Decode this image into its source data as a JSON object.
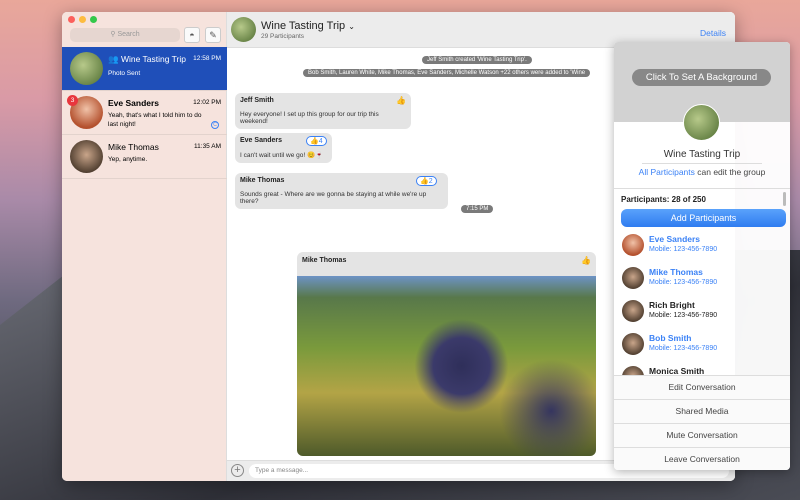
{
  "sidebar": {
    "search_placeholder": "Search",
    "conversations": [
      {
        "name": "Wine Tasting Trip",
        "time": "12:58 PM",
        "preview": "Photo Sent",
        "selected": true
      },
      {
        "name": "Eve Sanders",
        "time": "12:02 PM",
        "preview": "Yeah, that's what I told him to do last night!",
        "badge": "3"
      },
      {
        "name": "Mike Thomas",
        "time": "11:35 AM",
        "preview": "Yep, anytime."
      }
    ]
  },
  "header": {
    "title": "Wine Tasting Trip",
    "subtitle": "29 Participants",
    "details": "Details"
  },
  "chat": {
    "system": [
      "Jeff Smith created 'Wine Tasting Trip'.",
      "Bob Smith, Lauren White, Mike Thomas, Eve Sanders, Michelle Watson +22 others were added to 'Wine"
    ],
    "messages": [
      {
        "sender": "Jeff Smith",
        "text": "Hey everyone! I set up this group for our trip this weekend!"
      },
      {
        "sender": "Eve Sanders",
        "text": "I can't wait until we go! 😊🍷",
        "reaction": "4"
      },
      {
        "sender": "Mike Thomas",
        "text": "Sounds great - Where are we gonna be staying at while we're up there?",
        "reaction": "2"
      }
    ],
    "timestamp": "7:15 PM",
    "photo_sender": "Mike Thomas",
    "input_placeholder": "Type a message..."
  },
  "panel": {
    "background_button": "Click To Set A Background",
    "group_name": "Wine Tasting Trip",
    "edit_link": "All Participants",
    "edit_text": " can edit the group",
    "participants_count": "Participants: 28 of 250",
    "add_button": "Add Participants",
    "participants": [
      {
        "name": "Eve Sanders",
        "mobile": "Mobile: 123-456-7890",
        "color": "#3b82f6"
      },
      {
        "name": "Mike Thomas",
        "mobile": "Mobile: 123-456-7890",
        "color": "#3b82f6"
      },
      {
        "name": "Rich Bright",
        "mobile": "Mobile: 123-456-7890",
        "color": "#222222"
      },
      {
        "name": "Bob Smith",
        "mobile": "Mobile: 123-456-7890",
        "color": "#3b82f6"
      },
      {
        "name": "Monica Smith",
        "mobile": "",
        "color": "#222222"
      }
    ],
    "actions": [
      "Edit Conversation",
      "Shared Media",
      "Mute Conversation",
      "Leave Conversation"
    ]
  },
  "colors": {
    "accent": "#1f4fb9",
    "link": "#3b82f6"
  }
}
